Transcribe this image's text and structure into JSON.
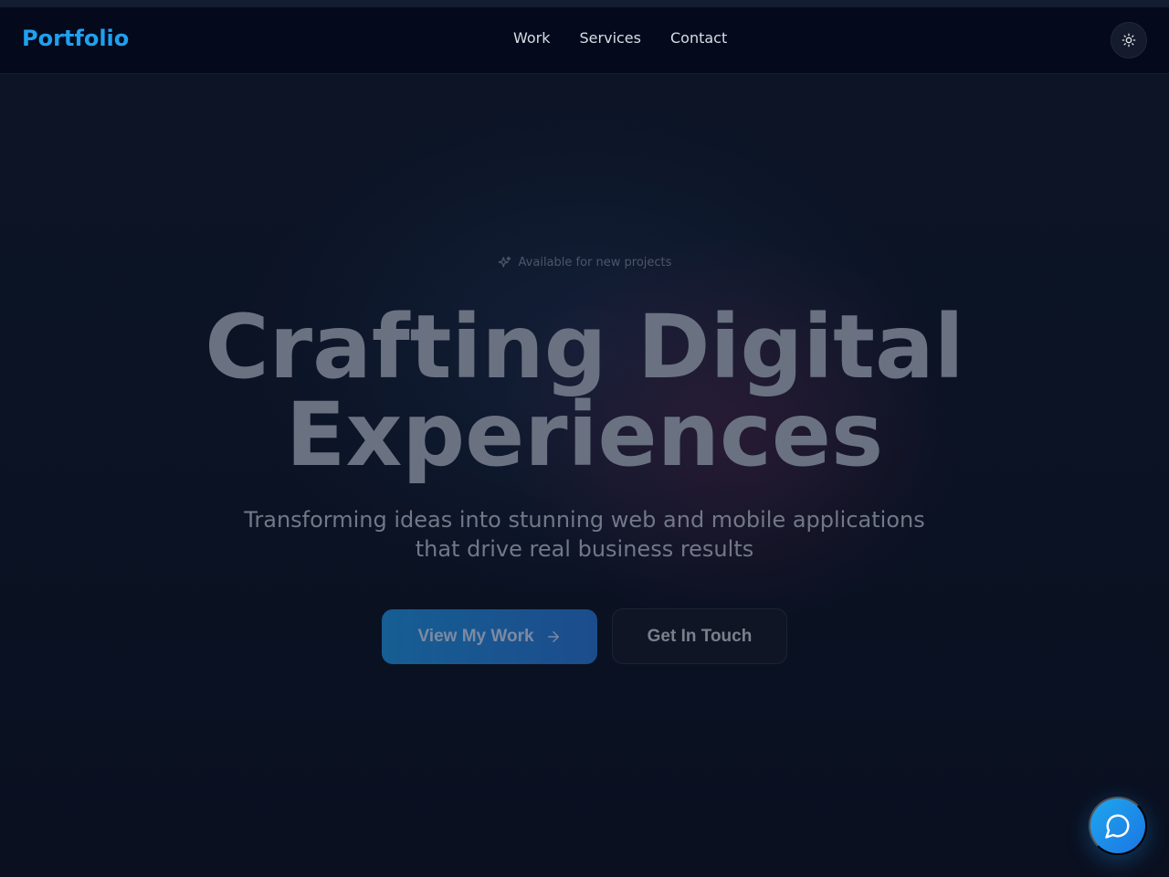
{
  "header": {
    "logo": "Portfolio",
    "nav": [
      {
        "label": "Work"
      },
      {
        "label": "Services"
      },
      {
        "label": "Contact"
      }
    ],
    "theme_toggle_icon": "sun-icon"
  },
  "hero": {
    "badge_icon": "sparkles-icon",
    "badge": "Available for new projects",
    "headline_line1": "Crafting Digital",
    "headline_line2": "Experiences",
    "subtext_line1": "Transforming ideas into stunning web and mobile applications",
    "subtext_line2": "that drive real business results",
    "primary_cta": "View My Work",
    "primary_cta_icon": "arrow-right-icon",
    "secondary_cta": "Get In Touch"
  },
  "chat": {
    "icon": "chat-bubble-icon"
  },
  "colors": {
    "brand": "#1fa0f0",
    "background": "#0a1020",
    "primary_button": "#1c5a92",
    "chat_button": "#1b8ee8"
  }
}
